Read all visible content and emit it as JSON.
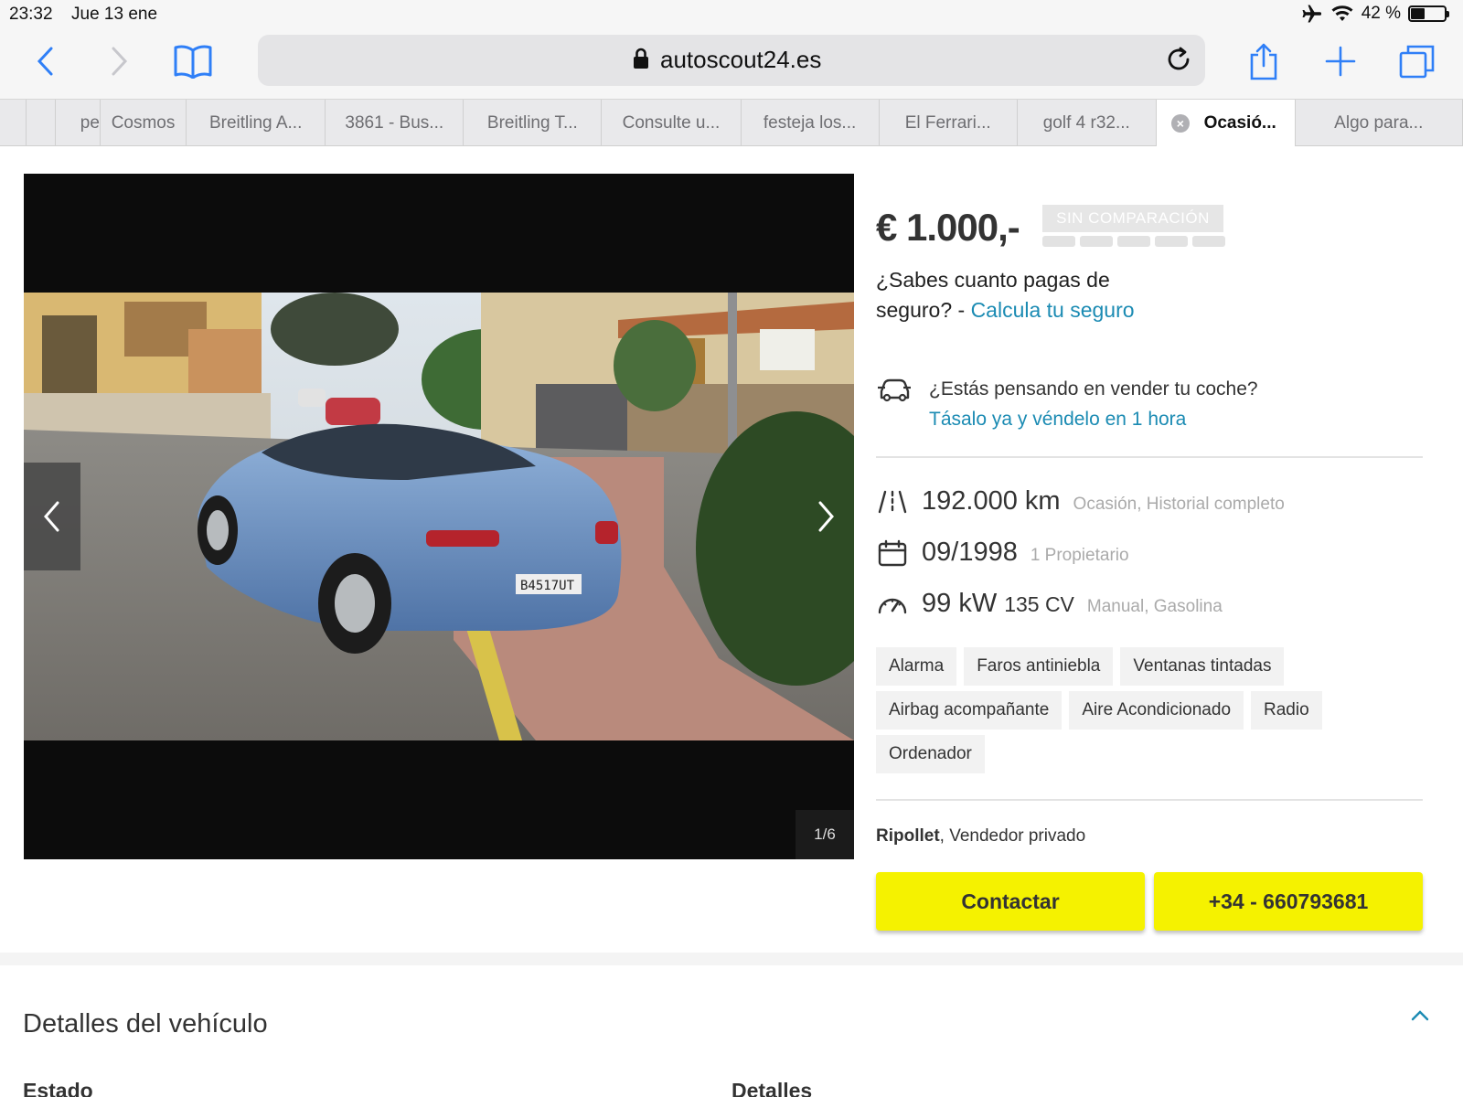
{
  "status": {
    "time": "23:32",
    "date": "Jue 13 ene",
    "battery": "42 %",
    "battery_level": 0.42
  },
  "browser": {
    "url": "autoscout24.es",
    "tabs": [
      {
        "label": ""
      },
      {
        "label": "pe"
      },
      {
        "label": "Cosmos"
      },
      {
        "label": "Breitling A..."
      },
      {
        "label": "3861 - Bus..."
      },
      {
        "label": "Breitling T..."
      },
      {
        "label": "Consulte u..."
      },
      {
        "label": "festeja los..."
      },
      {
        "label": "El Ferrari..."
      },
      {
        "label": "golf 4 r32..."
      },
      {
        "label": "Ocasió...",
        "active": true
      },
      {
        "label": "Algo para..."
      }
    ]
  },
  "gallery": {
    "counter": "1/6"
  },
  "listing": {
    "price": "€ 1.000,-",
    "badge": "SIN COMPARACIÓN",
    "insurance_text": "¿Sabes cuanto pagas de seguro? - ",
    "insurance_link": "Calcula tu seguro",
    "sell_question": "¿Estás pensando en vender tu coche?",
    "sell_link": "Tásalo ya y véndelo en 1 hora",
    "specs": {
      "mileage": "192.000 km",
      "mileage_sub": "Ocasión, Historial completo",
      "date": "09/1998",
      "date_sub": "1 Propietario",
      "power_kw": "99 kW",
      "power_cv": "135 CV",
      "power_sub": "Manual, Gasolina"
    },
    "features": [
      "Alarma",
      "Faros antiniebla",
      "Ventanas tintadas",
      "Airbag acompañante",
      "Aire Acondicionado",
      "Radio",
      "Ordenador"
    ],
    "seller_city": "Ripollet",
    "seller_type": ", Vendedor privado",
    "contact_label": "Contactar",
    "phone_label": "+34 - 660793681"
  },
  "details": {
    "title": "Detalles del vehículo",
    "col1": "Estado",
    "col2": "Detalles"
  },
  "colors": {
    "accent_link": "#1b8bb3",
    "cta_yellow": "#f5f200",
    "ios_blue": "#2f7ff7"
  }
}
